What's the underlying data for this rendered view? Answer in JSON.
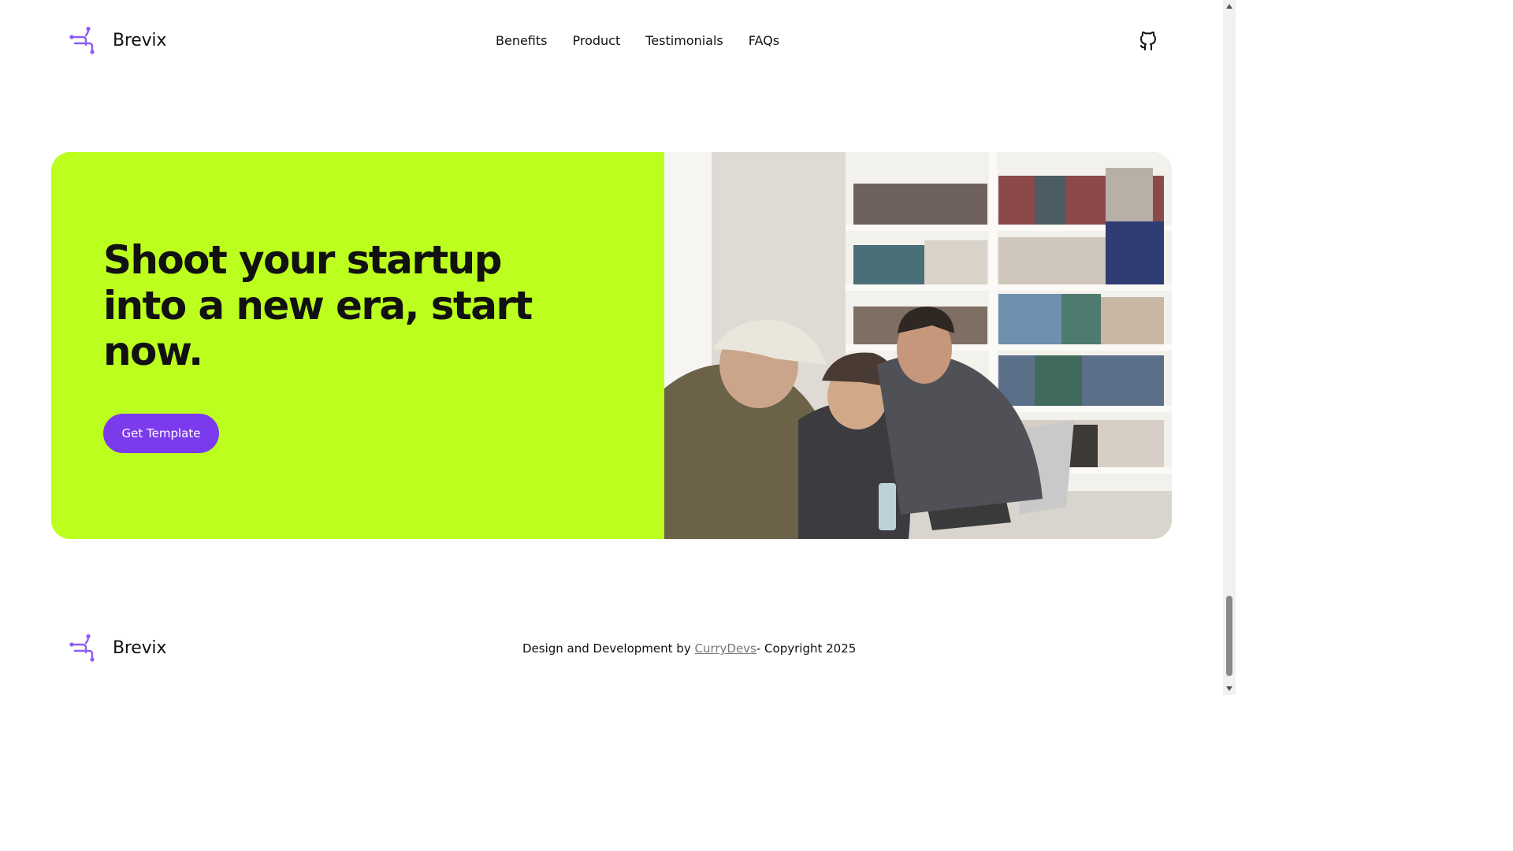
{
  "brand": {
    "name": "Brevix",
    "logo_icon": "brevix-logo-icon",
    "accent_color": "#8b5cf6"
  },
  "nav": {
    "items": [
      {
        "label": "Benefits"
      },
      {
        "label": "Product"
      },
      {
        "label": "Testimonials"
      },
      {
        "label": "FAQs"
      }
    ]
  },
  "header": {
    "github_icon": "github-icon"
  },
  "hero": {
    "headline_line1": "Shoot your startup",
    "headline_line2": "into a new era, start",
    "headline_line3": "now.",
    "cta_label": "Get Template",
    "background_color": "#bcff1f",
    "cta_color": "#7c3aed",
    "image": "photo-three-men-laughing-at-laptop-in-library"
  },
  "footer": {
    "brand_name": "Brevix",
    "credits_prefix": "Design and Development by ",
    "credits_link": "CurryDevs",
    "credits_suffix": "- Copyright 2025"
  },
  "scrollbar": {
    "up_icon": "arrow-up-icon",
    "down_icon": "arrow-down-icon"
  }
}
